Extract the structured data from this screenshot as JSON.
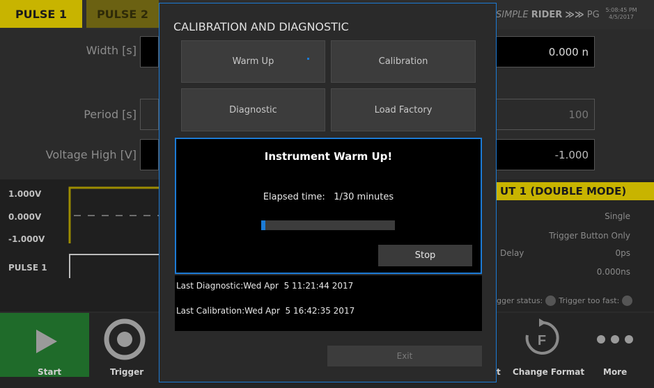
{
  "app": {
    "tabs": [
      "PULSE 1",
      "PULSE 2"
    ],
    "brand": {
      "simple": "SIMPLE",
      "rider": "RIDER",
      "arrows": "≫≫",
      "pg": "PG"
    },
    "clock": {
      "time": "5:08:45 PM",
      "date": "4/5/2017"
    },
    "fields": {
      "width_label": "Width [s]",
      "period_label": "Period [s]",
      "voltage_high_label": "Voltage High [V]",
      "width_value": "0.000 n",
      "period_value": "100",
      "voltage_value": "-1.000"
    },
    "waveform": {
      "v_high": "1.000V",
      "v_zero": "0.000V",
      "v_low": "-1.000V",
      "pulse_label": "PULSE 1"
    },
    "output_panel": {
      "title": "UT 1 (DOUBLE MODE)",
      "mode": "Single",
      "trigger": "Trigger Button Only",
      "delay_label": "Delay",
      "delay_value": "0ps",
      "value2": "0.000ns",
      "trigger_status": "gger status:",
      "trigger_too_fast": "Trigger too fast:"
    },
    "bottom": {
      "start": "Start",
      "trigger": "Trigger",
      "t": "t",
      "change_format": "Change Format",
      "more": "More"
    },
    "colors": {
      "accent_yellow": "#c8b400",
      "accent_blue": "#1c7bd6",
      "start_green": "#1f6b2a"
    }
  },
  "dialog": {
    "title": "CALIBRATION AND DIAGNOSTIC",
    "buttons": {
      "warm_up": "Warm Up",
      "calibration": "Calibration",
      "diagnostic": "Diagnostic",
      "load_factory": "Load Factory"
    },
    "warm_up_panel": {
      "heading": "Instrument Warm Up!",
      "elapsed_label": "Elapsed time:",
      "elapsed_value": "1/30 minutes",
      "progress_fraction": 0.033,
      "stop_label": "Stop"
    },
    "last_diagnostic": "Last Diagnostic:Wed Apr  5 11:21:44 2017",
    "last_calibration": "Last Calibration:Wed Apr  5 16:42:35 2017",
    "exit_label": "Exit"
  }
}
